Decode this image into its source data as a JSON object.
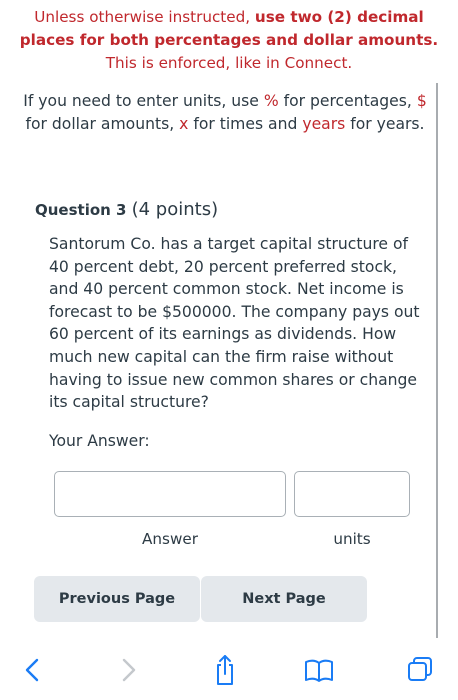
{
  "notice": {
    "line1_pre": "Unless otherwise instructed, ",
    "line1_bold": "use two (2) decimal",
    "line2_bold": "places for both percentages and dollar amounts.",
    "line3": "This is enforced, like in Connect."
  },
  "units_note": {
    "t1": "If you need to enter units, use ",
    "pct": "%",
    "t2": " for percentages, ",
    "dollar": "$",
    "t3": " for dollar amounts, ",
    "times": "x",
    "t4": " for times and ",
    "years": "years",
    "t5": " for years."
  },
  "question": {
    "label": "Question 3",
    "points": "(4 points)",
    "body": "Santorum Co. has a target capital structure of 40 percent debt, 20 percent preferred stock, and 40 percent common stock. Net income is forecast to be $500000. The company pays out 60 percent of its earnings as dividends. How much new capital can the firm raise without having to issue new common shares or change its capital structure?",
    "your_answer_label": "Your Answer:"
  },
  "answer": {
    "answer_value": "",
    "units_value": "",
    "answer_label": "Answer",
    "units_label": "units"
  },
  "nav": {
    "previous": "Previous Page",
    "next": "Next Page"
  },
  "toolbar": {
    "icons": [
      "back-icon",
      "forward-icon",
      "share-icon",
      "bookmarks-icon",
      "tabs-icon"
    ]
  },
  "colors": {
    "accent_red": "#c0282d",
    "text": "#2d3b45",
    "button_bg": "#e4e8ec",
    "toolbar_blue": "#1a7cf5"
  }
}
